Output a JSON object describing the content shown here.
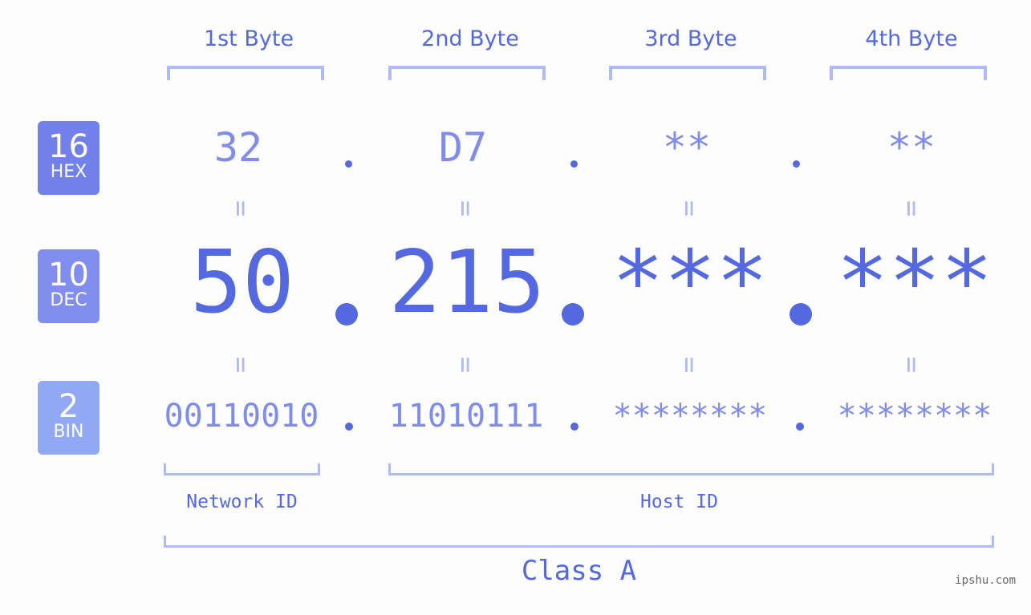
{
  "bytes": [
    {
      "header": "1st Byte",
      "hex": "32",
      "dec": "50",
      "bin": "00110010"
    },
    {
      "header": "2nd Byte",
      "hex": "D7",
      "dec": "215",
      "bin": "11010111"
    },
    {
      "header": "3rd Byte",
      "hex": "**",
      "dec": "***",
      "bin": "********"
    },
    {
      "header": "4th Byte",
      "hex": "**",
      "dec": "***",
      "bin": "********"
    }
  ],
  "badges": {
    "hex": {
      "num": "16",
      "label": "HEX",
      "color": "#7180eb"
    },
    "dec": {
      "num": "10",
      "label": "DEC",
      "color": "#818ef0"
    },
    "bin": {
      "num": "2",
      "label": "BIN",
      "color": "#91a8f7"
    }
  },
  "equals_sign": "=",
  "network_label": "Network ID",
  "host_label": "Host ID",
  "class_label": "Class A",
  "watermark": "ipshu.com"
}
